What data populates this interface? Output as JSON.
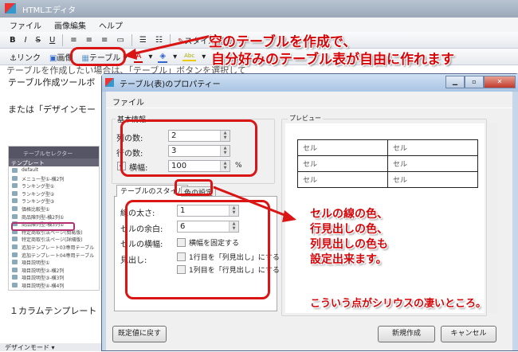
{
  "app": {
    "title": "HTMLエディタ",
    "menu": [
      "ファイル",
      "画像編集",
      "ヘルプ"
    ],
    "toolbar1": [
      "B",
      "I",
      "S",
      "U",
      "スタイル消去"
    ],
    "toolbar2": {
      "link": "リンク",
      "image": "画像",
      "table": "テーブル"
    }
  },
  "content": {
    "line1": "テーブルを作成したい場合は、「テーブル」ボタンを選択して",
    "line2": "テーブル作成ツールボ",
    "line3": "または「デザインモー",
    "line4": "１カラムテンプレート",
    "status": "デザインモード"
  },
  "selector": {
    "title": "テーブルセレクター",
    "column": "テンプレート",
    "items": [
      "default",
      "メニュー型①-横2列",
      "ランキング型①",
      "ランキング型②",
      "ランキング型③",
      "価格比較型①",
      "商品陳列型-横2列①",
      "商品陳列型-横3列①",
      "特定商取引法ページ(簡易版)",
      "特定商取引法ページ(詳細版)",
      "追加テンプレート03専用テーブル",
      "追加テンプレート04専用テーブル",
      "項目説明型①",
      "項目説明型②-横2列",
      "項目説明型③-横3列",
      "項目説明型④-横4列"
    ]
  },
  "dialog": {
    "title": "テーブル(表)のプロパティー",
    "menu": "ファイル",
    "basic_group": "基本情報",
    "cols_label": "列の数:",
    "cols": "2",
    "rows_label": "行の数:",
    "rows": "3",
    "width_label": "横幅:",
    "width": "100",
    "width_unit": "%",
    "width_checked": true,
    "tabs": [
      "テーブルのスタイル",
      "色の設定"
    ],
    "border_label": "線の太さ:",
    "border": "1",
    "padding_label": "セルの余白:",
    "padding": "6",
    "cellwidth_label": "セルの横幅:",
    "fix_width": "横幅を固定する",
    "heading_label": "見出し:",
    "row_heading": "1行目を「列見出し」にする",
    "col_heading": "1列目を「行見出し」にする",
    "preview_group": "プレビュー",
    "cells": [
      [
        "セル",
        "セル"
      ],
      [
        "セル",
        "セル"
      ],
      [
        "セル",
        "セル"
      ]
    ],
    "reset": "既定値に戻す",
    "create": "新規作成",
    "cancel": "キャンセル"
  },
  "annotations": {
    "top1": "空のテーブルを作成で、",
    "top2": "自分好みのテーブル表が自由に作れます",
    "right": [
      "セルの線の色、",
      "行見出しの色、",
      "列見出しの色も",
      "設定出来ます。"
    ],
    "bottom": "こういう点がシリウスの凄いところ。"
  },
  "colors": {
    "annotation": "#d4060a",
    "dialog_title": "#a9c4e4"
  }
}
